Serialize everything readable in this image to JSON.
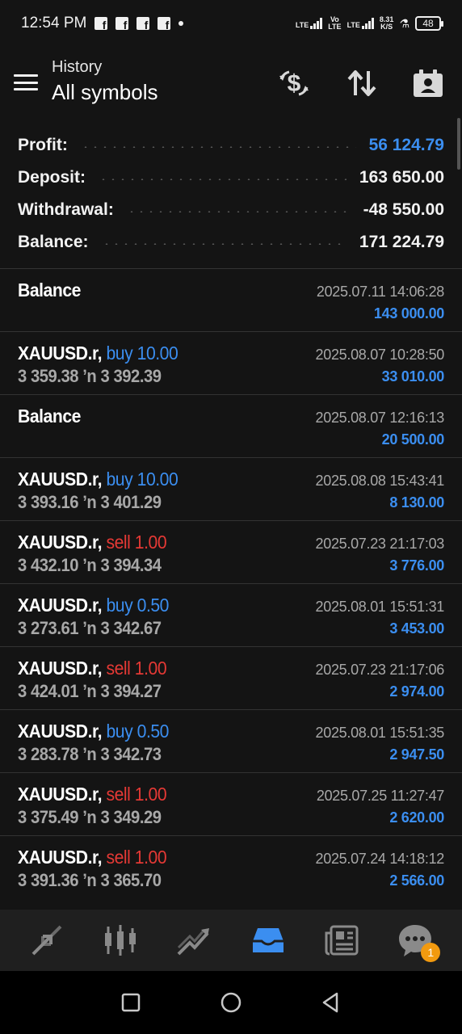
{
  "status": {
    "time": "12:54 PM",
    "net1_top": "LTE",
    "net2_top": "Vo",
    "net2_bottom": "LTE",
    "net3_top": "LTE",
    "speed_top": "8.31",
    "speed_bottom": "K/S",
    "battery": "48"
  },
  "header": {
    "subtitle": "History",
    "title": "All symbols"
  },
  "summary": {
    "profit_label": "Profit:",
    "profit_value": "56 124.79",
    "deposit_label": "Deposit:",
    "deposit_value": "163 650.00",
    "withdrawal_label": "Withdrawal:",
    "withdrawal_value": "-48 550.00",
    "balance_label": "Balance:",
    "balance_value": "171 224.79"
  },
  "deals": [
    {
      "symbol": "Balance",
      "side": "",
      "volume": "",
      "prices": "",
      "time": "2025.07.11 14:06:28",
      "amount": "143 000.00"
    },
    {
      "symbol": "XAUUSD.r,",
      "side": "buy",
      "volume": "10.00",
      "prices": "3 359.38 ʼn  3 392.39",
      "time": "2025.08.07 10:28:50",
      "amount": "33 010.00"
    },
    {
      "symbol": "Balance",
      "side": "",
      "volume": "",
      "prices": "",
      "time": "2025.08.07 12:16:13",
      "amount": "20 500.00"
    },
    {
      "symbol": "XAUUSD.r,",
      "side": "buy",
      "volume": "10.00",
      "prices": "3 393.16 ʼn  3 401.29",
      "time": "2025.08.08 15:43:41",
      "amount": "8 130.00"
    },
    {
      "symbol": "XAUUSD.r,",
      "side": "sell",
      "volume": "1.00",
      "prices": "3 432.10 ʼn  3 394.34",
      "time": "2025.07.23 21:17:03",
      "amount": "3 776.00"
    },
    {
      "symbol": "XAUUSD.r,",
      "side": "buy",
      "volume": "0.50",
      "prices": "3 273.61 ʼn  3 342.67",
      "time": "2025.08.01 15:51:31",
      "amount": "3 453.00"
    },
    {
      "symbol": "XAUUSD.r,",
      "side": "sell",
      "volume": "1.00",
      "prices": "3 424.01 ʼn  3 394.27",
      "time": "2025.07.23 21:17:06",
      "amount": "2 974.00"
    },
    {
      "symbol": "XAUUSD.r,",
      "side": "buy",
      "volume": "0.50",
      "prices": "3 283.78 ʼn  3 342.73",
      "time": "2025.08.01 15:51:35",
      "amount": "2 947.50"
    },
    {
      "symbol": "XAUUSD.r,",
      "side": "sell",
      "volume": "1.00",
      "prices": "3 375.49 ʼn  3 349.29",
      "time": "2025.07.25 11:27:47",
      "amount": "2 620.00"
    },
    {
      "symbol": "XAUUSD.r,",
      "side": "sell",
      "volume": "1.00",
      "prices": "3 391.36 ʼn  3 365.70",
      "time": "2025.07.24 14:18:12",
      "amount": "2 566.00"
    }
  ],
  "nav": {
    "items": [
      "quotes-icon",
      "chart-icon",
      "trade-icon",
      "history-icon",
      "news-icon",
      "chat-icon"
    ],
    "chat_badge": "1"
  },
  "colors": {
    "accent": "#3b8ef0",
    "sell": "#e53935",
    "background": "#141414"
  }
}
